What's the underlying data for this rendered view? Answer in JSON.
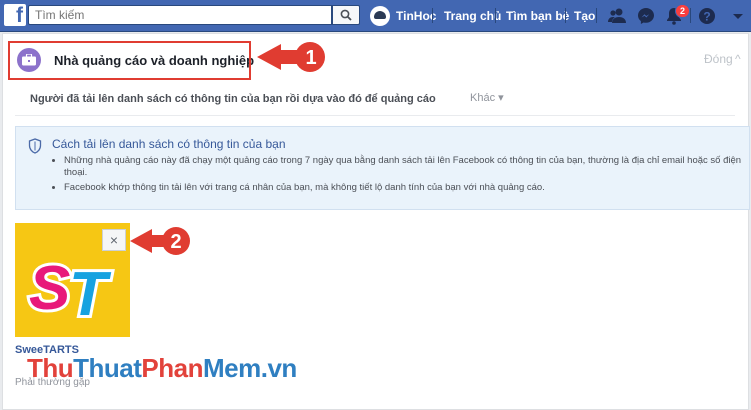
{
  "topbar": {
    "logo": "f",
    "search_placeholder": "Tìm kiếm",
    "profile_name": "TinHoc",
    "nav": [
      "Trang chủ",
      "Tìm bạn bè",
      "Tạo"
    ],
    "notification_count": "2"
  },
  "category": {
    "title": "Nhà quảng cáo và doanh nghiệp",
    "close_label": "Đóng",
    "close_chevron": "^"
  },
  "tabs": {
    "active": "Người đã tải lên danh sách có thông tin của bạn rồi dựa vào đó để quảng cáo",
    "other": "Khác ▾"
  },
  "info": {
    "title": "Cách tải lên danh sách có thông tin của bạn",
    "bullets": [
      "Những nhà quảng cáo này đã chạy một quảng cáo trong 7 ngày qua bằng danh sách tải lên Facebook có thông tin của bạn, thường là địa chỉ email hoặc số điện thoại.",
      "Facebook khớp thông tin tải lên với trang cá nhân của bạn, mà không tiết lộ danh tính của bạn với nhà quảng cáo."
    ]
  },
  "advertiser": {
    "logo_text": "ST",
    "name": "SweeTARTS",
    "remove_symbol": "×"
  },
  "footer_text": "Phải thường gặp",
  "callouts": [
    "1",
    "2"
  ],
  "watermark": [
    "Thu",
    "Thuat",
    "Phan",
    "Mem.vn"
  ],
  "colors": {
    "header": "#4267b2",
    "highlight": "#e03c31",
    "link": "#365899",
    "logo_bg": "#f6c714"
  }
}
